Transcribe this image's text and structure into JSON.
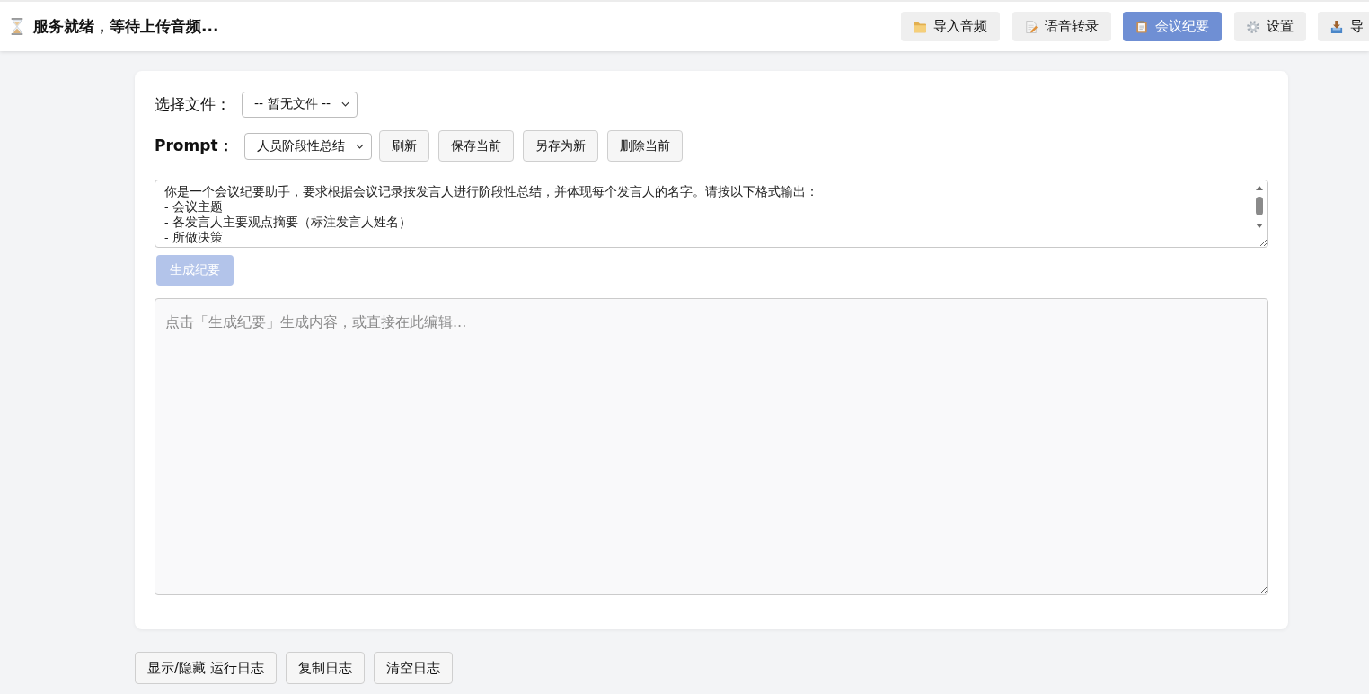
{
  "header": {
    "status": "服务就绪，等待上传音频...",
    "nav": [
      {
        "label": "导入音频",
        "selected": false
      },
      {
        "label": "语音转录",
        "selected": false
      },
      {
        "label": "会议纪要",
        "selected": true
      },
      {
        "label": "设置",
        "selected": false
      },
      {
        "label": "导",
        "selected": false
      }
    ]
  },
  "file_row": {
    "label": "选择文件：",
    "select_value": "-- 暂无文件 --"
  },
  "prompt_row": {
    "label": "Prompt：",
    "select_value": "人员阶段性总结",
    "buttons": [
      "刷新",
      "保存当前",
      "另存为新",
      "删除当前"
    ]
  },
  "prompt_text": {
    "value": "你是一个会议纪要助手，要求根据会议记录按发言人进行阶段性总结，并体现每个发言人的名字。请按以下格式输出：\n- 会议主题\n- 各发言人主要观点摘要（标注发言人姓名）\n- 所做决策"
  },
  "generate_button": {
    "label": "生成纪要",
    "disabled": true
  },
  "output": {
    "placeholder": "点击「生成纪要」生成内容，或直接在此编辑..."
  },
  "log_buttons": [
    "显示/隐藏 运行日志",
    "复制日志",
    "清空日志"
  ]
}
